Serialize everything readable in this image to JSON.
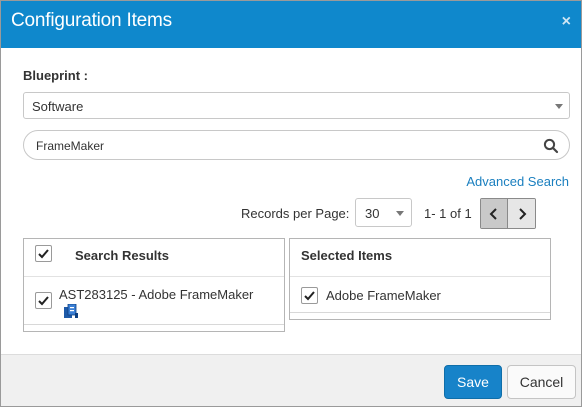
{
  "dialog": {
    "title": "Configuration Items",
    "close_glyph": "×"
  },
  "blueprint": {
    "label": "Blueprint :",
    "selected": "Software"
  },
  "search": {
    "value": "FrameMaker",
    "icon": "search-icon"
  },
  "advanced_search_label": "Advanced Search",
  "pagination": {
    "records_label": "Records per Page:",
    "per_page": "30",
    "range": "1- 1 of 1"
  },
  "search_results": {
    "header": "Search Results",
    "header_checked": true,
    "items": [
      {
        "label": "AST283125 - Adobe FrameMaker",
        "checked": true,
        "icon": "software-asset-icon"
      }
    ]
  },
  "selected_items": {
    "header": "Selected Items",
    "items": [
      {
        "label": "Adobe FrameMaker",
        "checked": true
      }
    ]
  },
  "footer": {
    "save_label": "Save",
    "cancel_label": "Cancel"
  },
  "colors": {
    "header_bg": "#0f88cc",
    "primary_button": "#1783c9",
    "link": "#1a7fbf"
  }
}
